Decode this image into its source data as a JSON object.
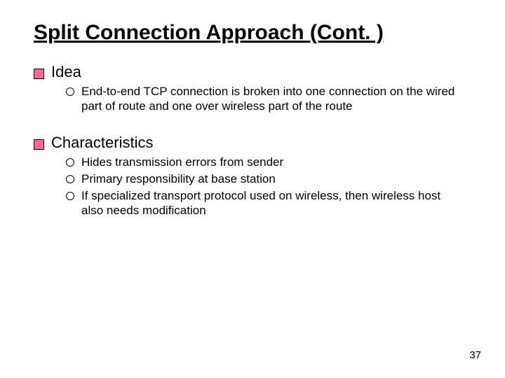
{
  "title": "Split Connection Approach (Cont. )",
  "sections": [
    {
      "heading": "Idea",
      "items": [
        "End-to-end TCP connection is broken into one connection on the wired part of route and one over wireless part of the route"
      ]
    },
    {
      "heading": "Characteristics",
      "items": [
        "Hides transmission errors from sender",
        "Primary responsibility at base station",
        "If specialized transport protocol used on wireless, then wireless host also needs modification"
      ]
    }
  ],
  "page_number": "37"
}
